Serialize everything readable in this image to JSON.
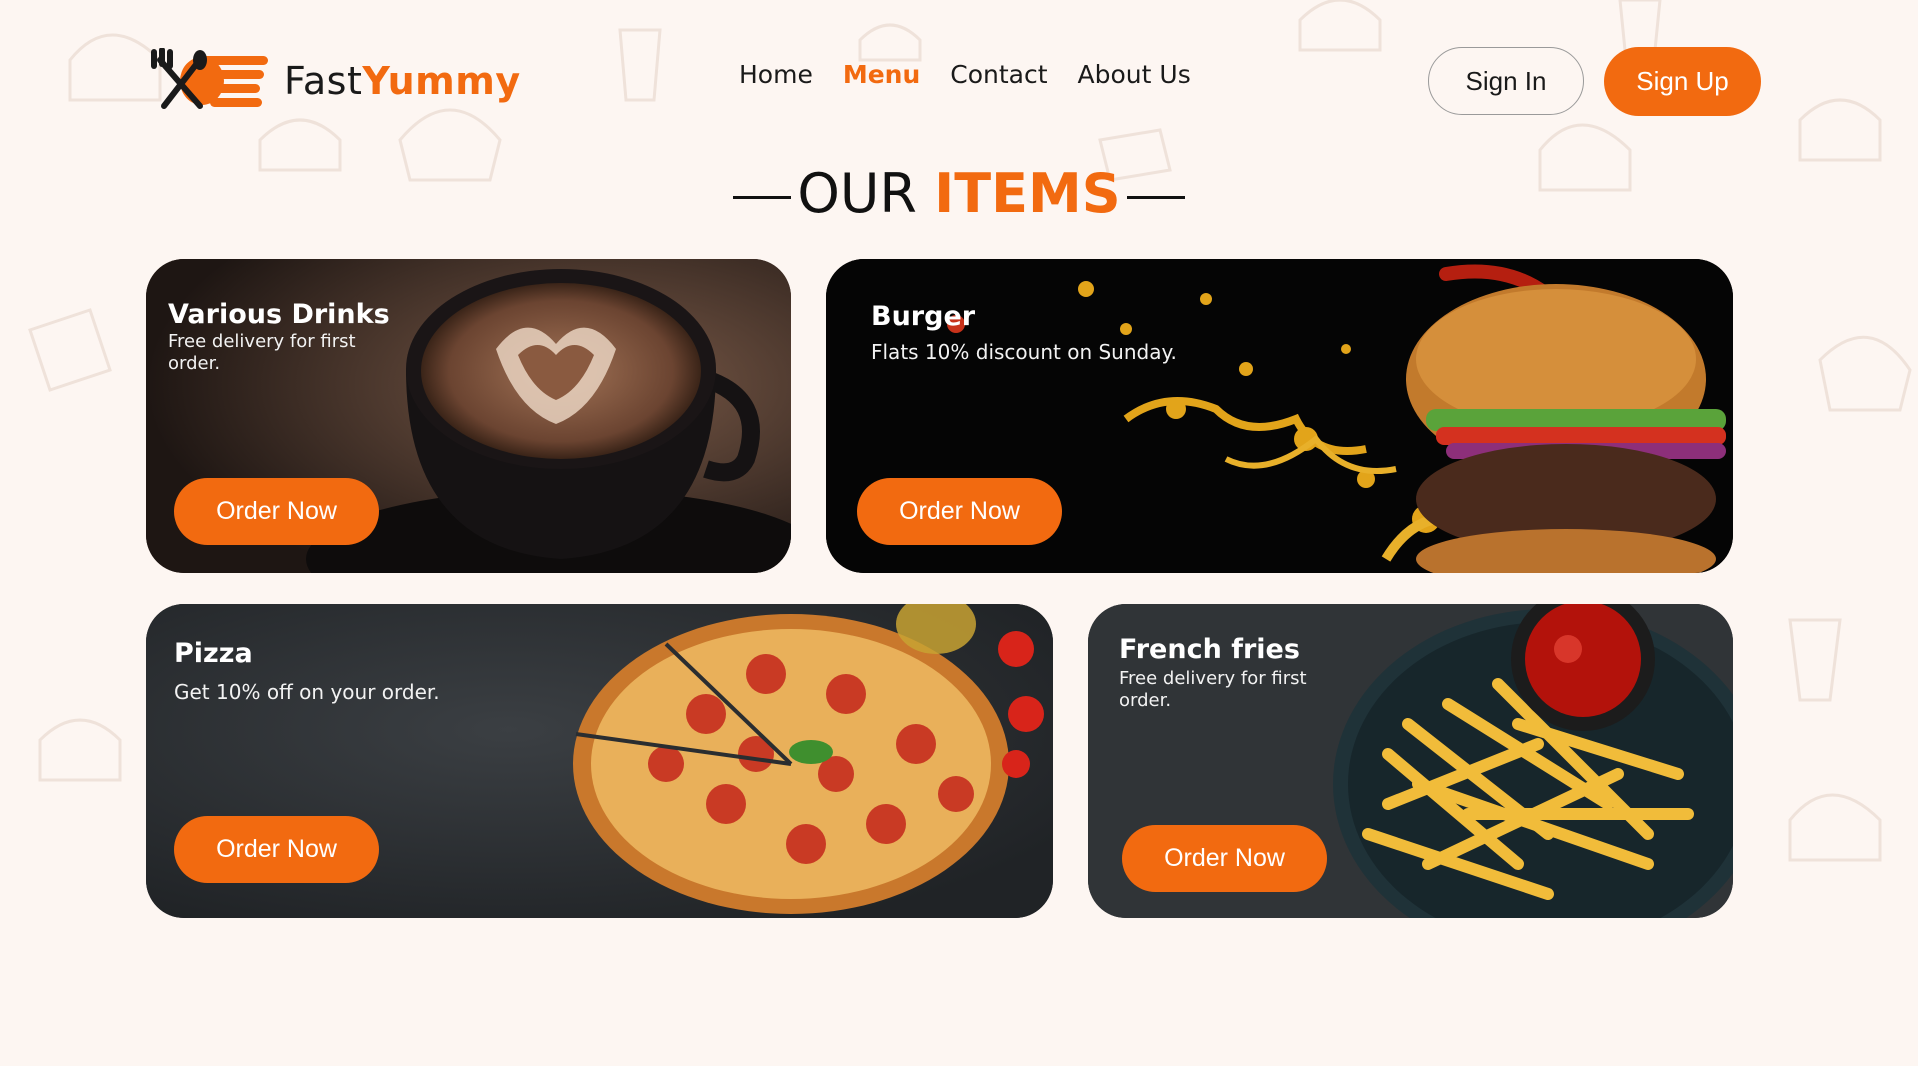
{
  "brand": {
    "name_part1": "Fast",
    "name_part2": "Yummy",
    "accent": "#f26a10"
  },
  "nav": {
    "items": [
      {
        "label": "Home",
        "active": false
      },
      {
        "label": "Menu",
        "active": true
      },
      {
        "label": "Contact",
        "active": false
      },
      {
        "label": "About Us",
        "active": false
      }
    ]
  },
  "auth": {
    "sign_in": "Sign In",
    "sign_up": "Sign Up"
  },
  "section": {
    "title_part1": "OUR",
    "title_part2": "ITEMS"
  },
  "cards": [
    {
      "title": "Various Drinks",
      "subtitle_line1": "Free delivery for first",
      "subtitle_line2": "order.",
      "button": "Order Now",
      "icon": "coffee-cup-image"
    },
    {
      "title": "Burger",
      "subtitle_line1": "Flats 10% discount on Sunday.",
      "subtitle_line2": "",
      "button": "Order Now",
      "icon": "burger-image"
    },
    {
      "title": "Pizza",
      "subtitle_line1": "Get 10% off on your order.",
      "subtitle_line2": "",
      "button": "Order Now",
      "icon": "pizza-image"
    },
    {
      "title": "French fries",
      "subtitle_line1": "Free delivery for first",
      "subtitle_line2": "order.",
      "button": "Order Now",
      "icon": "fries-image"
    }
  ]
}
